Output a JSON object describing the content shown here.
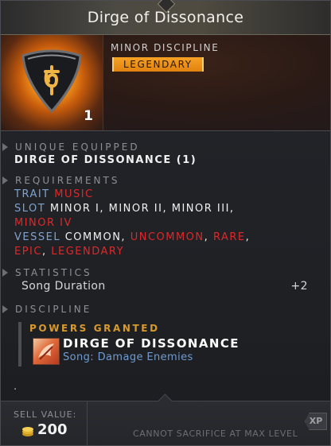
{
  "item": {
    "title": "Dirge of Dissonance",
    "icon": "rune-gem-icon",
    "count": "1",
    "type": "MINOR DISCIPLINE",
    "rarity": "LEGENDARY",
    "rarity_color": "#f39a1e"
  },
  "unique_equipped": {
    "heading": "UNIQUE EQUIPPED",
    "value": "DIRGE OF DISSONANCE (1)"
  },
  "requirements": {
    "heading": "REQUIREMENTS",
    "trait_label": "TRAIT",
    "trait_value": "MUSIC",
    "slot_label": "SLOT",
    "slot_values": "MINOR I, MINOR II, MINOR III,",
    "slot_unmet": "MINOR IV",
    "vessel_label": "VESSEL",
    "vessel_common": "COMMON",
    "vessel_uncommon": "UNCOMMON",
    "vessel_rare": "RARE",
    "vessel_epic": "EPIC",
    "vessel_legendary": "LEGENDARY",
    "sep": ","
  },
  "statistics": {
    "heading": "STATISTICS",
    "rows": [
      {
        "name": "Song Duration",
        "value": "+2"
      }
    ]
  },
  "discipline": {
    "heading": "DISCIPLINE",
    "powers_heading": "POWERS GRANTED",
    "power_name": "DIRGE OF DISSONANCE",
    "power_desc": "Song: Damage Enemies",
    "power_icon": "song-power-icon",
    "trailing": "."
  },
  "footer": {
    "sell_label": "SELL VALUE:",
    "sell_value": "200",
    "coin_icon": "coin-stack-icon",
    "sacrifice_note": "CANNOT SACRIFICE AT MAX LEVEL",
    "xp_label": "XP"
  }
}
